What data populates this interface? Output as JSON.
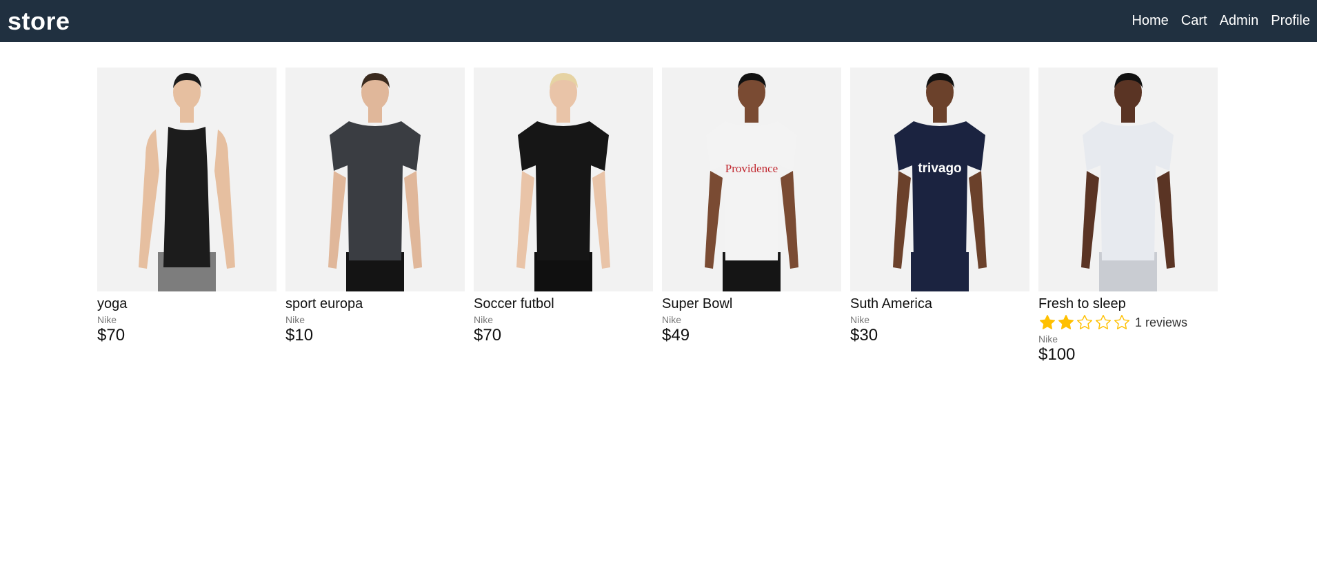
{
  "header": {
    "brand": "store",
    "nav": [
      "Home",
      "Cart",
      "Admin",
      "Profile"
    ]
  },
  "products": [
    {
      "name": "yoga",
      "brand": "Nike",
      "price": "$70",
      "image": "black sleeveless tank top",
      "shirt": "#1c1c1c",
      "shorts": "#7d7d7d",
      "skin": "#e6bfa0",
      "hair": "#1a1a1a"
    },
    {
      "name": "sport europa",
      "brand": "Nike",
      "price": "$10",
      "image": "grey camo t-shirt",
      "shirt": "#3a3d42",
      "shorts": "#141414",
      "skin": "#e0b79a",
      "hair": "#3a2a1e"
    },
    {
      "name": "Soccer futbol",
      "brand": "Nike",
      "price": "$70",
      "image": "black polo shirt",
      "shirt": "#161616",
      "shorts": "#101010",
      "skin": "#e9c4a8",
      "hair": "#e6d3a3"
    },
    {
      "name": "Super Bowl",
      "brand": "Nike",
      "price": "$49",
      "image": "white Providence jersey",
      "shirt": "#f3f3f3",
      "shorts": "#151515",
      "skin": "#7a4b33",
      "hair": "#111111",
      "logo_text": "Providence"
    },
    {
      "name": "Suth America",
      "brand": "Nike",
      "price": "$30",
      "image": "navy trivago jersey",
      "shirt": "#1b2340",
      "shorts": "#1b2340",
      "skin": "#6b412b",
      "hair": "#111111",
      "logo_text": "trivago"
    },
    {
      "name": "Fresh to sleep",
      "brand": "Nike",
      "price": "$100",
      "image": "white training t-shirt",
      "shirt": "#e7eaef",
      "shorts": "#c9ccd2",
      "skin": "#5a3424",
      "hair": "#111111",
      "rating": 2,
      "rating_max": 5,
      "reviews": "1 reviews"
    }
  ],
  "colors": {
    "header_bg": "#203040",
    "star": "#ffc000"
  }
}
